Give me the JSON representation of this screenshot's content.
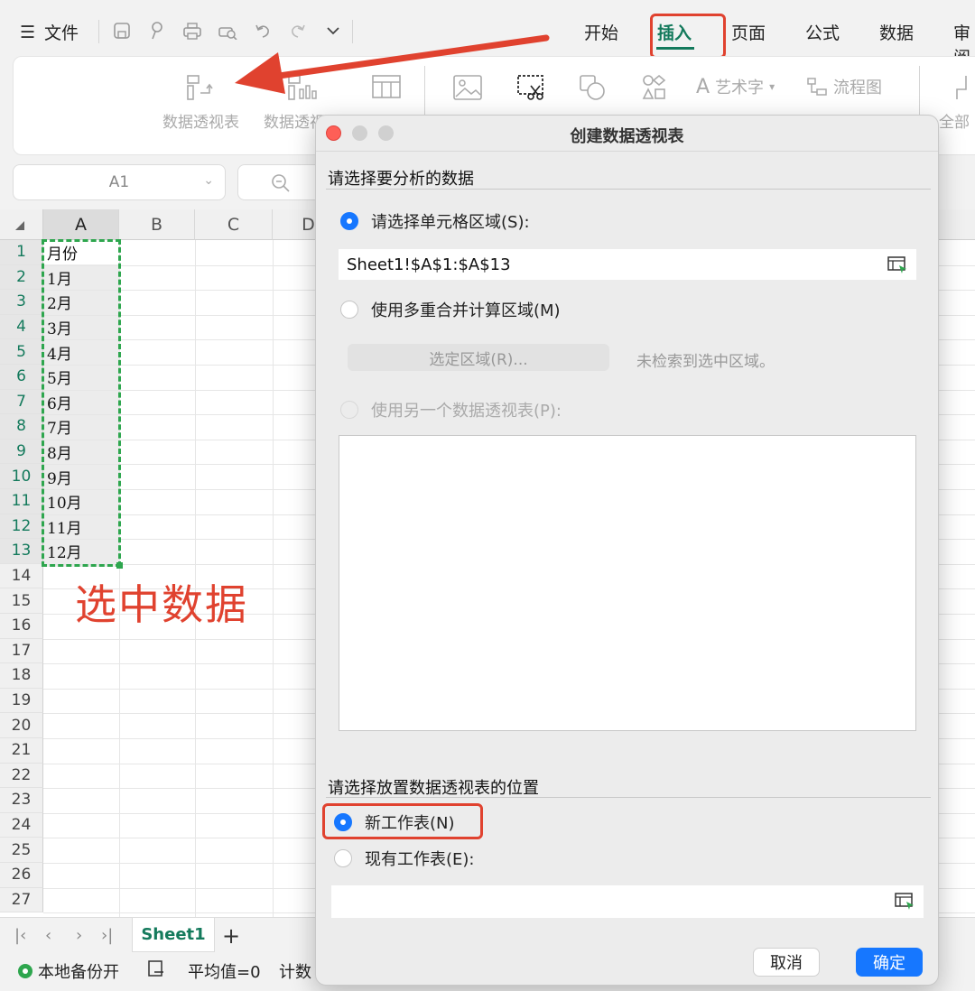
{
  "app": {
    "file_menu": "文件",
    "tabs": [
      "开始",
      "插入",
      "页面",
      "公式",
      "数据",
      "审阅"
    ],
    "active_tab": "插入"
  },
  "ribbon": {
    "pivot_table": "数据透视表",
    "pivot_chart": "数据透视图",
    "table": "表格",
    "picture": "图片",
    "screenshot": "截屏",
    "shape": "形状",
    "icon": "图标",
    "wordart": "艺术字",
    "flowchart": "流程图",
    "all": "全部"
  },
  "namebox": {
    "value": "A1"
  },
  "grid": {
    "columns": [
      "A",
      "B",
      "C",
      "D"
    ],
    "rows": [
      "1",
      "2",
      "3",
      "4",
      "5",
      "6",
      "7",
      "8",
      "9",
      "10",
      "11",
      "12",
      "13",
      "14",
      "15",
      "16",
      "17",
      "18",
      "19",
      "20",
      "21",
      "22",
      "23",
      "24",
      "25",
      "26",
      "27"
    ],
    "col_a": [
      "月份",
      "1月",
      "2月",
      "3月",
      "4月",
      "5月",
      "6月",
      "7月",
      "8月",
      "9月",
      "10月",
      "11月",
      "12月"
    ],
    "annotation": "选中数据"
  },
  "sheet_tabs": {
    "active": "Sheet1",
    "add": "+"
  },
  "status": {
    "backup": "本地备份开",
    "average": "平均值=0",
    "count": "计数"
  },
  "dialog": {
    "title": "创建数据透视表",
    "section1": "请选择要分析的数据",
    "opt_range": "请选择单元格区域(S):",
    "range_value": "Sheet1!$A$1:$A$13",
    "opt_multi": "使用多重合并计算区域(M)",
    "select_region_btn": "选定区域(R)...",
    "no_region": "未检索到选中区域。",
    "opt_other_pivot": "使用另一个数据透视表(P):",
    "section2": "请选择放置数据透视表的位置",
    "opt_new_sheet": "新工作表(N)",
    "opt_existing_sheet": "现有工作表(E):",
    "existing_value": "",
    "cancel": "取消",
    "ok": "确定"
  },
  "colors": {
    "accent": "#147a5c",
    "highlight_red": "#e0422f",
    "selection_green": "#2ea64e",
    "primary_blue": "#1677ff"
  }
}
